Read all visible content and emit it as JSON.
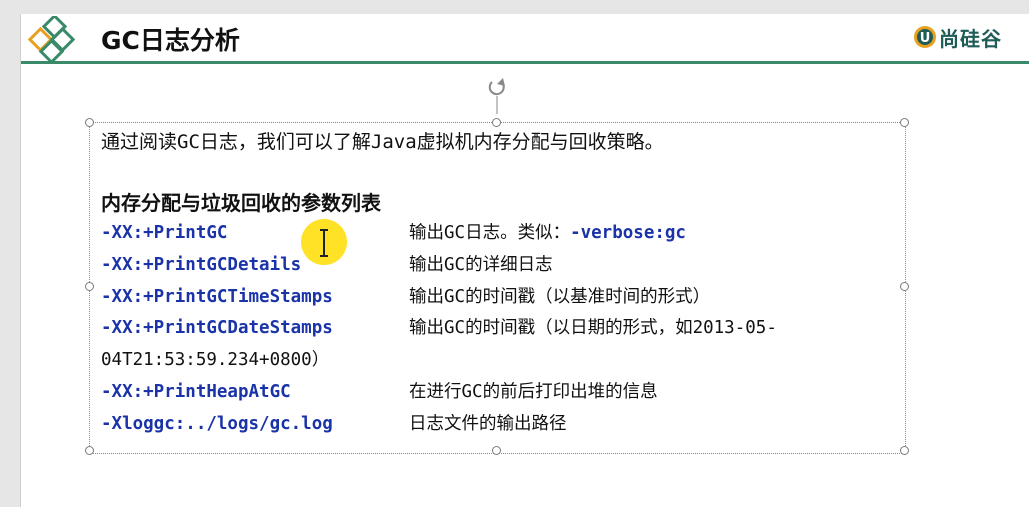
{
  "header": {
    "title": "GC日志分析",
    "brand_text": "尚硅谷",
    "brand_letter": "U",
    "accent_color": "#3a8a6a",
    "brand_color": "#1f5c58"
  },
  "textbox": {
    "intro": "通过阅读GC日志，我们可以了解Java虚拟机内存分配与回收策略。",
    "section_title": "内存分配与垃圾回收的参数列表",
    "params": [
      {
        "flag": "-XX:+PrintGC",
        "desc": "输出GC日志。类似：",
        "desc_flag": "-verbose:gc"
      },
      {
        "flag": "-XX:+PrintGCDetails",
        "desc": "输出GC的详细日志"
      },
      {
        "flag": "-XX:+PrintGCTimeStamps",
        "desc": "输出GC的时间戳（以基准时间的形式）"
      },
      {
        "flag": "-XX:+PrintGCDateStamps",
        "desc": "输出GC的时间戳（以日期的形式，如2013-05-",
        "desc_cont": "04T21:53:59.234+0800）"
      },
      {
        "flag": "-XX:+PrintHeapAtGC",
        "desc": "在进行GC的前后打印出堆的信息"
      },
      {
        "flag": "-Xloggc:../logs/gc.log",
        "desc": "日志文件的输出路径"
      }
    ],
    "flag_color": "#1a33a8"
  },
  "icons": {
    "logo": "diamond-logo-icon",
    "brand": "brand-badge-icon",
    "rotate": "rotate-handle-icon",
    "cursor": "text-cursor-icon"
  }
}
